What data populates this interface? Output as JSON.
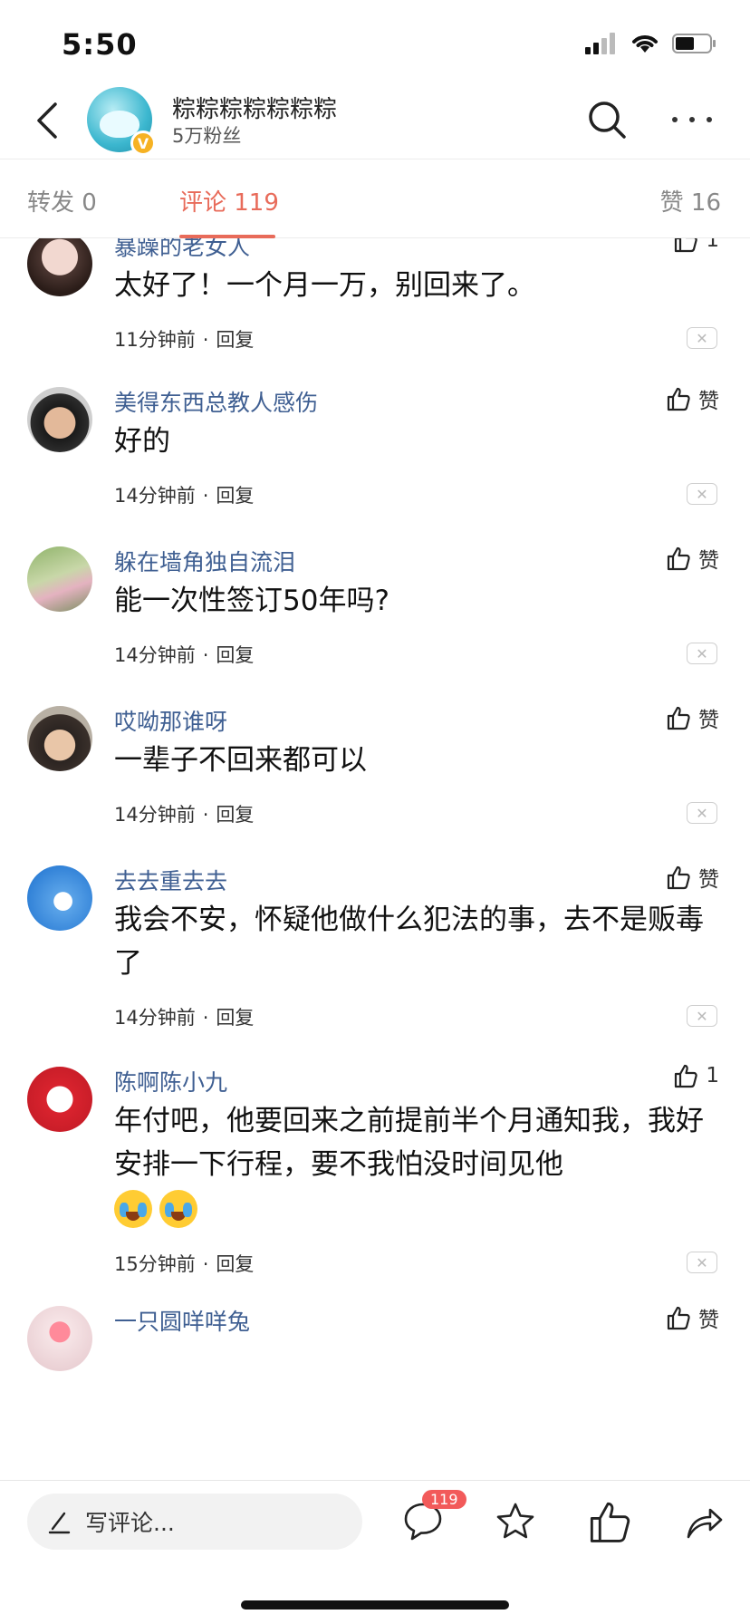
{
  "status_bar": {
    "time": "5:50"
  },
  "header": {
    "name": "粽粽粽粽粽粽粽",
    "fans": "5万粉丝",
    "badge": "V"
  },
  "tabs": {
    "forward": "转发 0",
    "comments": "评论 119",
    "likes": "赞 16"
  },
  "comments": [
    {
      "name": "暴躁的老女人",
      "like": "1",
      "text": "太好了！一个月一万，别回来了。",
      "time": "11分钟前",
      "reply": "回复"
    },
    {
      "name": "美得东西总教人感伤",
      "like": "赞",
      "text": "好的",
      "time": "14分钟前",
      "reply": "回复"
    },
    {
      "name": "躲在墙角独自流泪",
      "like": "赞",
      "text": "能一次性签订50年吗?",
      "time": "14分钟前",
      "reply": "回复"
    },
    {
      "name": "哎呦那谁呀",
      "like": "赞",
      "text": "一辈子不回来都可以",
      "time": "14分钟前",
      "reply": "回复"
    },
    {
      "name": "去去重去去",
      "like": "赞",
      "text": "我会不安，怀疑他做什么犯法的事，去不是贩毒了",
      "time": "14分钟前",
      "reply": "回复"
    },
    {
      "name": "陈啊陈小九",
      "like": "1",
      "text": "年付吧，他要回来之前提前半个月通知我，我好安排一下行程，要不我怕没时间见他",
      "time": "15分钟前",
      "reply": "回复"
    },
    {
      "name": "一只圆咩咩兔",
      "like": "赞"
    }
  ],
  "bottom_bar": {
    "input_placeholder": "写评论...",
    "comment_count": "119"
  },
  "colors": {
    "accent": "#e86b5a",
    "username": "#3f5f92",
    "badge_red": "#f25a5a"
  }
}
